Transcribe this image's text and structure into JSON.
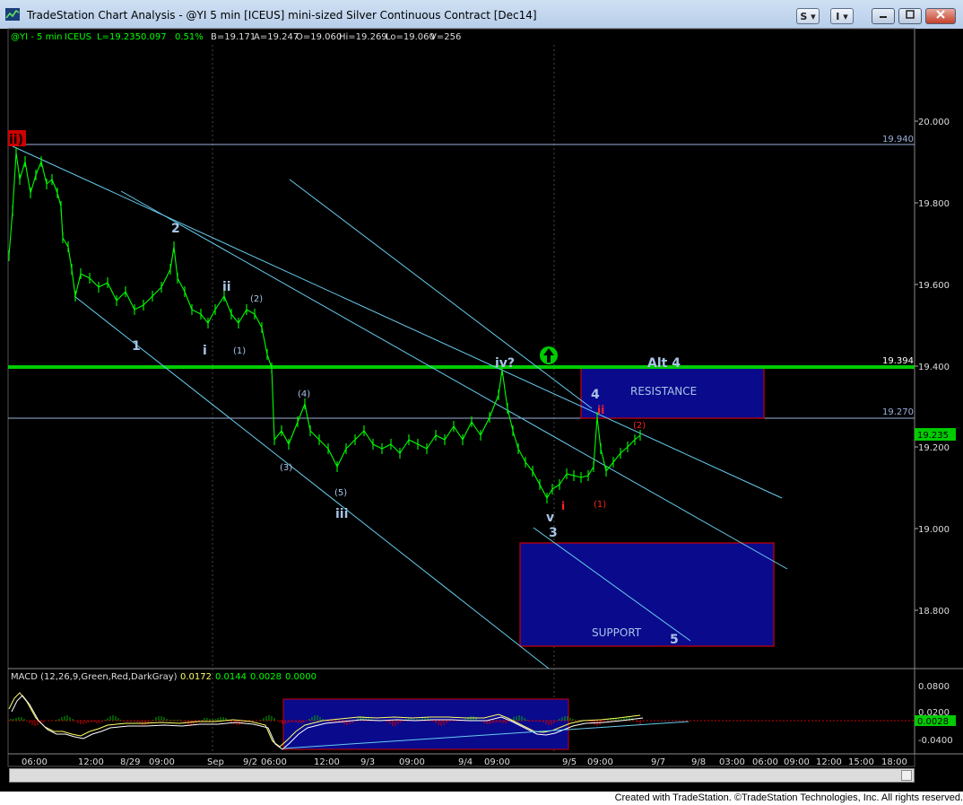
{
  "window": {
    "title": "TradeStation Chart Analysis - @YI 5 min [ICEUS] mini-sized Silver Continuous Contract [Dec14]",
    "buttons": {
      "s_label": "S",
      "i_label": "I"
    }
  },
  "status_bar": {
    "symbol": "@YI - 5 min",
    "exchange": "ICEUS",
    "last": "L=19.235",
    "change": "0.097",
    "pct": "0.51%",
    "bid": "B=19.171",
    "ask": "A=19.247",
    "open": "O=19.060",
    "high": "Hi=19.269",
    "low": "Lo=19.060",
    "volume": "V=256"
  },
  "price_axis": {
    "labels": [
      "20.000",
      "19.800",
      "19.600",
      "19.400",
      "19.200",
      "19.000",
      "18.800"
    ],
    "line_labels": [
      "19.940",
      "19.394",
      "19.270"
    ],
    "current_price": "19.235"
  },
  "time_axis": {
    "labels": [
      "06:00",
      "12:00",
      "8/29",
      "09:00",
      "Sep",
      "9/2",
      "06:00",
      "12:00",
      "9/3",
      "09:00",
      "9/4",
      "09:00",
      "9/5",
      "09:00",
      "9/7",
      "9/8",
      "03:00",
      "06:00",
      "09:00",
      "12:00",
      "15:00",
      "18:00"
    ]
  },
  "annotations": {
    "wave_ii_top": "ii)",
    "wave_1": "1",
    "wave_2": "2",
    "wave_i": "i",
    "wave_ii": "ii",
    "wave_sub1": "(1)",
    "wave_sub2": "(2)",
    "wave_sub3": "(3)",
    "wave_sub4": "(4)",
    "wave_sub5": "(5)",
    "wave_iii": "iii",
    "wave_iv": "iv?",
    "wave_v": "v",
    "wave_3": "3",
    "wave_4": "4",
    "wave_5": "5",
    "alt4": "Alt 4",
    "resistance": "RESISTANCE",
    "support": "SUPPORT",
    "red_i": "i",
    "red_ii": "ii",
    "red_sub1": "(1)",
    "red_sub2": "(2)"
  },
  "macd": {
    "label": "MACD (12,26,9,Green,Red,DarkGray)",
    "v1": "0.0172",
    "v2": "0.0144",
    "v3": "0.0028",
    "v4": "0.0000",
    "axis_labels": [
      "0.0800",
      "0.0200",
      "-0.0400"
    ],
    "current": "0.0028"
  },
  "footer": "Created with TradeStation. ©TradeStation Technologies, Inc. All rights reserved.",
  "colors": {
    "background": "#000000",
    "price_bars": "#00ff00",
    "trendlines": "#66ccee",
    "support_line": "#00cc00",
    "zone_fill": "#0a0a8c",
    "zone_border": "#cc0000",
    "wave_labels": "#a8c4e6",
    "red_labels": "#ff2020"
  }
}
